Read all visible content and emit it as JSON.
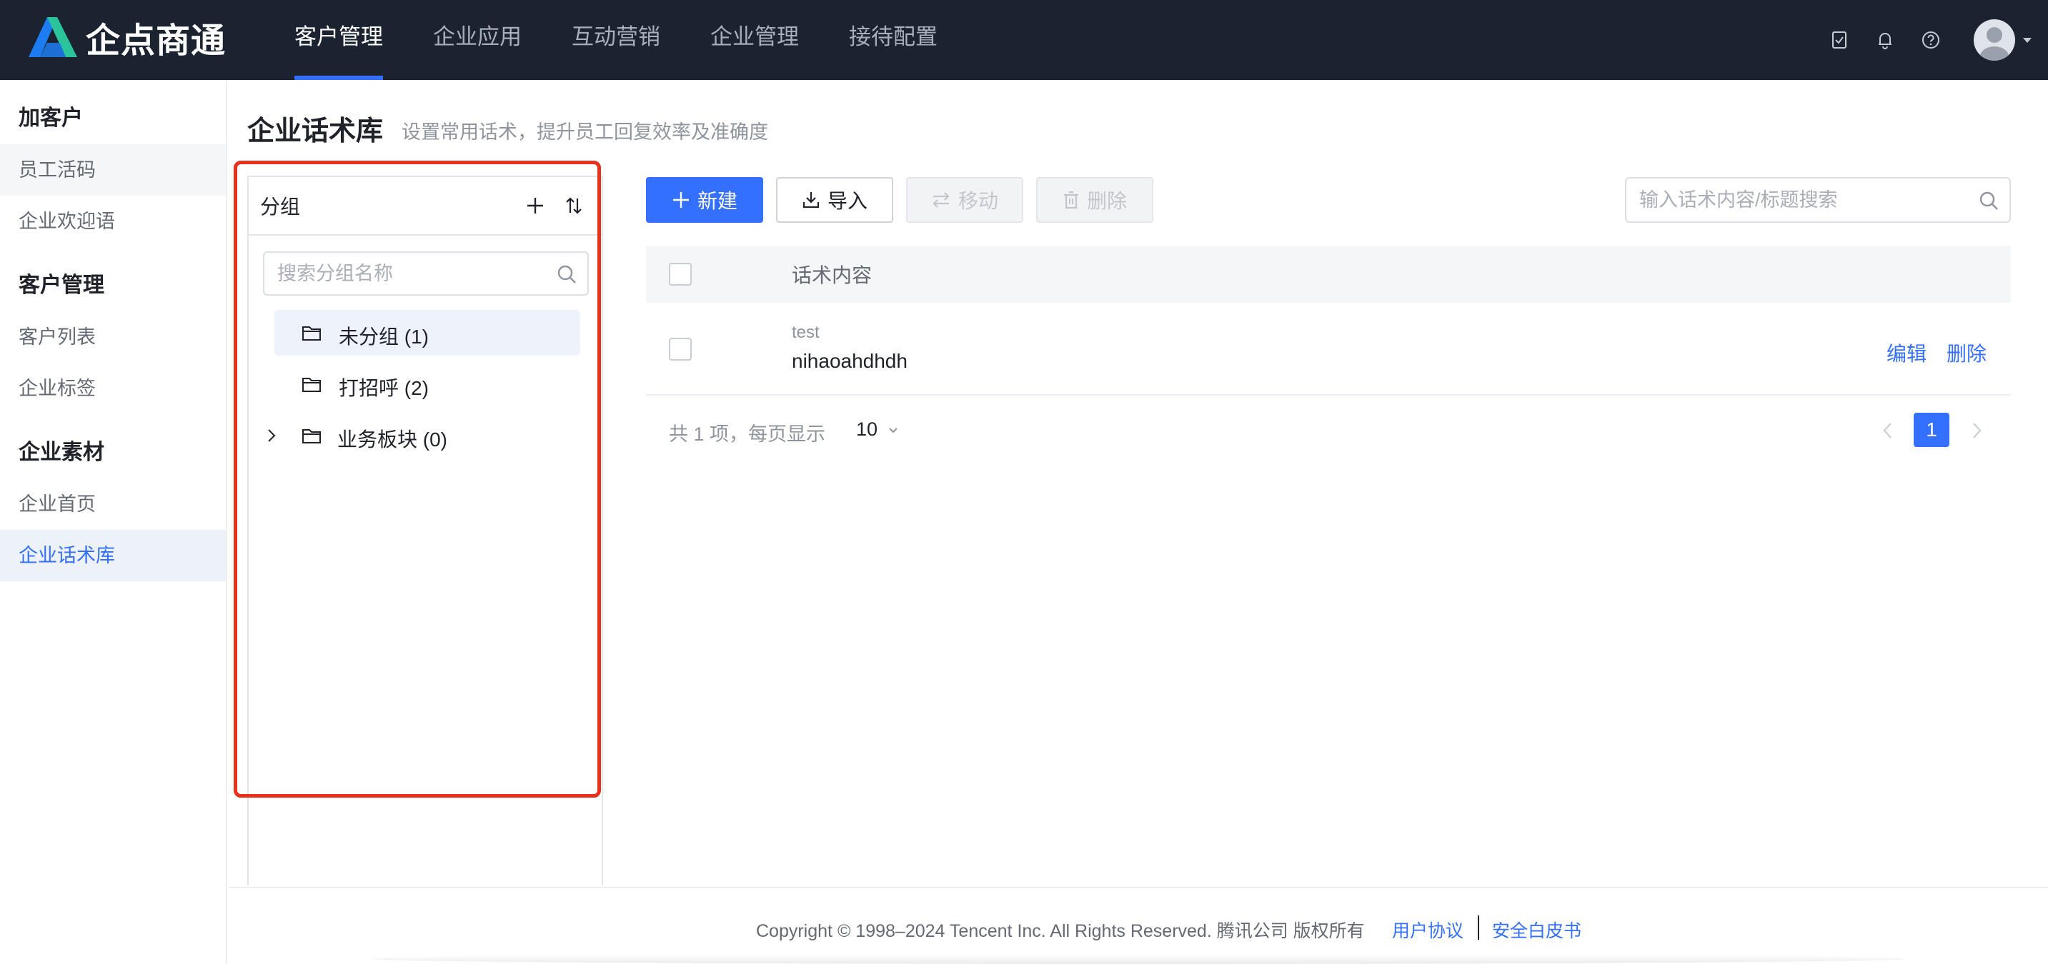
{
  "app": {
    "logo_text": "企点商通"
  },
  "topnav": {
    "items": [
      {
        "label": "客户管理",
        "active": true
      },
      {
        "label": "企业应用",
        "active": false
      },
      {
        "label": "互动营销",
        "active": false
      },
      {
        "label": "企业管理",
        "active": false
      },
      {
        "label": "接待配置",
        "active": false
      }
    ],
    "icons": [
      "task-check-icon",
      "bell-icon",
      "help-icon",
      "user-avatar"
    ]
  },
  "sidebar": {
    "sections": [
      {
        "title": "加客户",
        "items": [
          "员工活码",
          "企业欢迎语"
        ]
      },
      {
        "title": "客户管理",
        "items": [
          "客户列表",
          "企业标签"
        ]
      },
      {
        "title": "企业素材",
        "items": [
          "企业首页",
          "企业话术库"
        ]
      }
    ],
    "active_item": "企业话术库"
  },
  "page": {
    "title": "企业话术库",
    "subtitle": "设置常用话术，提升员工回复效率及准确度"
  },
  "group_panel": {
    "title": "分组",
    "search_placeholder": "搜索分组名称",
    "groups": [
      {
        "label": "未分组 (1)",
        "selected": true,
        "expandable": false
      },
      {
        "label": "打招呼 (2)",
        "selected": false,
        "expandable": false
      },
      {
        "label": "业务板块 (0)",
        "selected": false,
        "expandable": true
      }
    ]
  },
  "toolbar": {
    "new_label": "新建",
    "import_label": "导入",
    "move_label": "移动",
    "delete_label": "删除",
    "search_placeholder": "输入话术内容/标题搜索"
  },
  "table": {
    "column_header": "话术内容",
    "rows": [
      {
        "title": "test",
        "content": "nihaoahdhdh",
        "edit_label": "编辑",
        "delete_label": "删除"
      }
    ]
  },
  "pagination": {
    "total_text": "共 1 项，每页显示",
    "page_size": "10",
    "current_page": "1"
  },
  "footer": {
    "copyright": "Copyright © 1998–2024 Tencent Inc. All Rights Reserved. 腾讯公司 版权所有",
    "link_agreement": "用户协议",
    "link_whitepaper": "安全白皮书"
  },
  "colors": {
    "accent": "#3370ff",
    "topbar_bg": "#1b2331",
    "highlight_box": "#e8311a"
  }
}
